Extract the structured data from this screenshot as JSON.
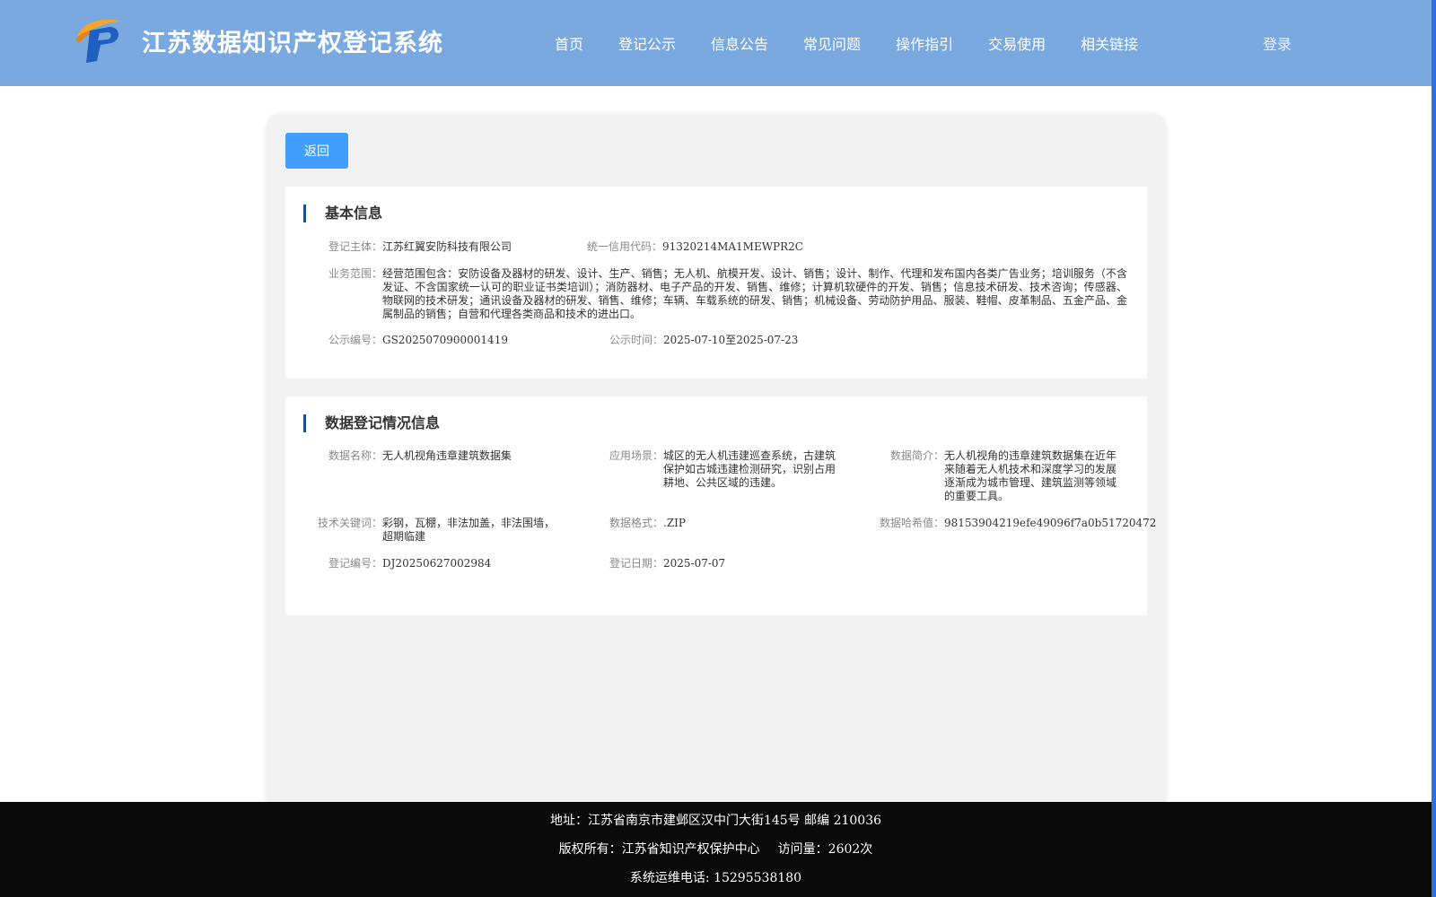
{
  "header": {
    "site_title": "江苏数据知识产权登记系统",
    "nav": [
      "首页",
      "登记公示",
      "信息公告",
      "常见问题",
      "操作指引",
      "交易使用",
      "相关链接"
    ],
    "login": "登录"
  },
  "back_button": "返回",
  "basic_info": {
    "title": "基本信息",
    "subject_label": "登记主体：",
    "subject": "江苏红翼安防科技有限公司",
    "credit_code_label": "统一信用代码：",
    "credit_code": "91320214MA1MEWPR2C",
    "scope_label": "业务范围：",
    "scope": "经营范围包含：安防设备及器材的研发、设计、生产、销售；无人机、航模开发、设计、销售；设计、制作、代理和发布国内各类广告业务；培训服务（不含发证、不含国家统一认可的职业证书类培训）；消防器材、电子产品的开发、销售、维修；计算机软硬件的开发、销售；信息技术研发、技术咨询；传感器、物联网的技术研发；通讯设备及器材的研发、销售、维修；车辆、车载系统的研发、销售；机械设备、劳动防护用品、服装、鞋帽、皮革制品、五金产品、金属制品的销售；自营和代理各类商品和技术的进出口。",
    "notice_no_label": "公示编号：",
    "notice_no": "GS2025070900001419",
    "notice_time_label": "公示时间：",
    "notice_time": "2025-07-10至2025-07-23"
  },
  "registration_info": {
    "title": "数据登记情况信息",
    "data_name_label": "数据名称：",
    "data_name": "无人机视角违章建筑数据集",
    "scenario_label": "应用场景：",
    "scenario": "城区的无人机违建巡查系统，古建筑保护如古城违建检测研究，识别占用耕地、公共区域的违建。",
    "intro_label": "数据简介：",
    "intro": "无人机视角的违章建筑数据集在近年来随着无人机技术和深度学习的发展逐渐成为城市管理、建筑监测等领域的重要工具。",
    "keywords_label": "技术关键词：",
    "keywords": "彩钢，瓦棚，非法加盖，非法围墙，超期临建",
    "format_label": "数据格式：",
    "format": ".ZIP",
    "hash_label": "数据哈希值：",
    "hash": "98153904219efe49096f7a0b51720472",
    "reg_no_label": "登记编号：",
    "reg_no": "DJ20250627002984",
    "reg_date_label": "登记日期：",
    "reg_date": "2025-07-07"
  },
  "footer": {
    "address": "地址：江苏省南京市建邺区汉中门大街145号 邮编 210036",
    "copyright": "版权所有：江苏省知识产权保护中心",
    "visits": "访问量：2602次",
    "phone": "系统运维电话: 15295538180"
  },
  "colors": {
    "header_bg": "#7aa9df",
    "primary_button": "#409eff",
    "title_accent": "#1c4f8f",
    "footer_bg": "#0a0a0a"
  },
  "icons": {
    "logo": "logo-icon"
  }
}
